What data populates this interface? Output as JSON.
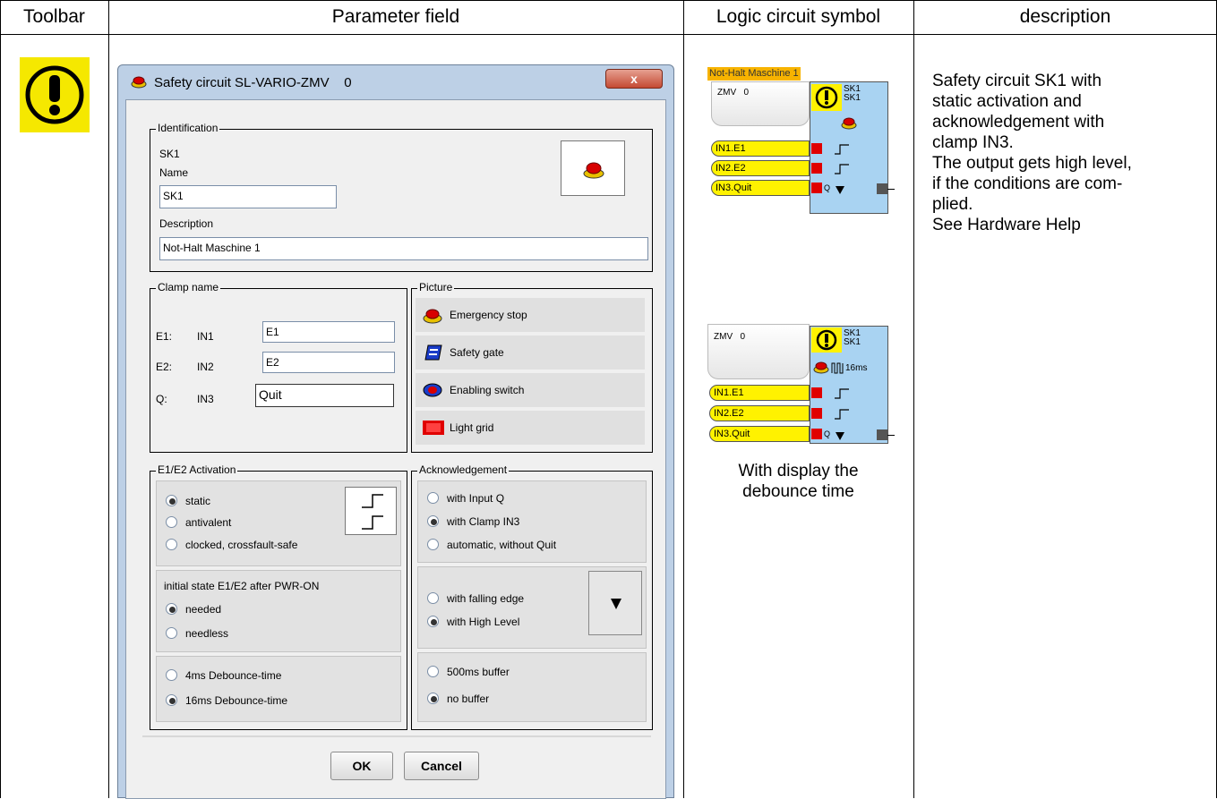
{
  "table": {
    "headers": [
      "Toolbar",
      "Parameter field",
      "Logic circuit symbol",
      "description"
    ],
    "description_lines": [
      "Safety circuit SK1 with",
      "static activation and",
      "acknowledgement with",
      "clamp IN3.",
      "The output gets high level,",
      "if the conditions are com-",
      "plied.",
      "See Hardware Help"
    ],
    "symbol_caption_lines": [
      "With display the",
      "debounce time"
    ]
  },
  "dialog": {
    "title": "Safety circuit SL-VARIO-ZMV",
    "title_number": "0",
    "close_label": "x",
    "identification": {
      "caption": "Identification",
      "id": "SK1",
      "name_label": "Name",
      "name_value": "SK1",
      "description_label": "Description",
      "description_value": "Not-Halt Maschine 1"
    },
    "clamp": {
      "caption": "Clamp name",
      "rows": [
        {
          "label": "E1:",
          "clamp": "IN1",
          "value": "E1"
        },
        {
          "label": "E2:",
          "clamp": "IN2",
          "value": "E2"
        },
        {
          "label": "Q:",
          "clamp": "IN3",
          "value": "Quit"
        }
      ]
    },
    "picture": {
      "caption": "Picture",
      "options": [
        "Emergency stop",
        "Safety gate",
        "Enabling switch",
        "Light grid"
      ]
    },
    "activation": {
      "caption": "E1/E2 Activation",
      "options": [
        {
          "label": "static",
          "selected": true
        },
        {
          "label": "antivalent",
          "selected": false
        },
        {
          "label": "clocked, crossfault-safe",
          "selected": false
        }
      ],
      "initial_state_title": "initial state E1/E2 after PWR-ON",
      "initial_state_options": [
        {
          "label": "needed",
          "selected": true
        },
        {
          "label": "needless",
          "selected": false
        }
      ],
      "debounce_options": [
        {
          "label": "4ms Debounce-time",
          "selected": false
        },
        {
          "label": "16ms Debounce-time",
          "selected": true
        }
      ]
    },
    "acknowledgement": {
      "caption": "Acknowledgement",
      "options": [
        {
          "label": "with Input Q",
          "selected": false
        },
        {
          "label": "with Clamp IN3",
          "selected": true
        },
        {
          "label": "automatic, without Quit",
          "selected": false
        }
      ],
      "edge_options": [
        {
          "label": "with falling edge",
          "selected": false
        },
        {
          "label": "with High Level",
          "selected": true
        }
      ],
      "buffer_options": [
        {
          "label": "500ms buffer",
          "selected": false
        },
        {
          "label": "no buffer",
          "selected": true
        }
      ]
    },
    "buttons": {
      "ok": "OK",
      "cancel": "Cancel"
    }
  },
  "symbols": {
    "top_label": "Not-Halt Maschine 1",
    "zmv_label": "ZMV",
    "zmv_number": "0",
    "sk_lines": [
      "SK1",
      "SK1"
    ],
    "inputs": [
      "IN1.E1",
      "IN2.E2",
      "IN3.Quit"
    ],
    "q_label": "Q",
    "debounce_label": "16ms"
  },
  "colors": {
    "warning_yellow": "#f5e800",
    "symbol_blue": "#a9d3f2",
    "input_yellow": "#fff200",
    "clamp_red": "#e00000",
    "label_orange": "#f7b300"
  }
}
